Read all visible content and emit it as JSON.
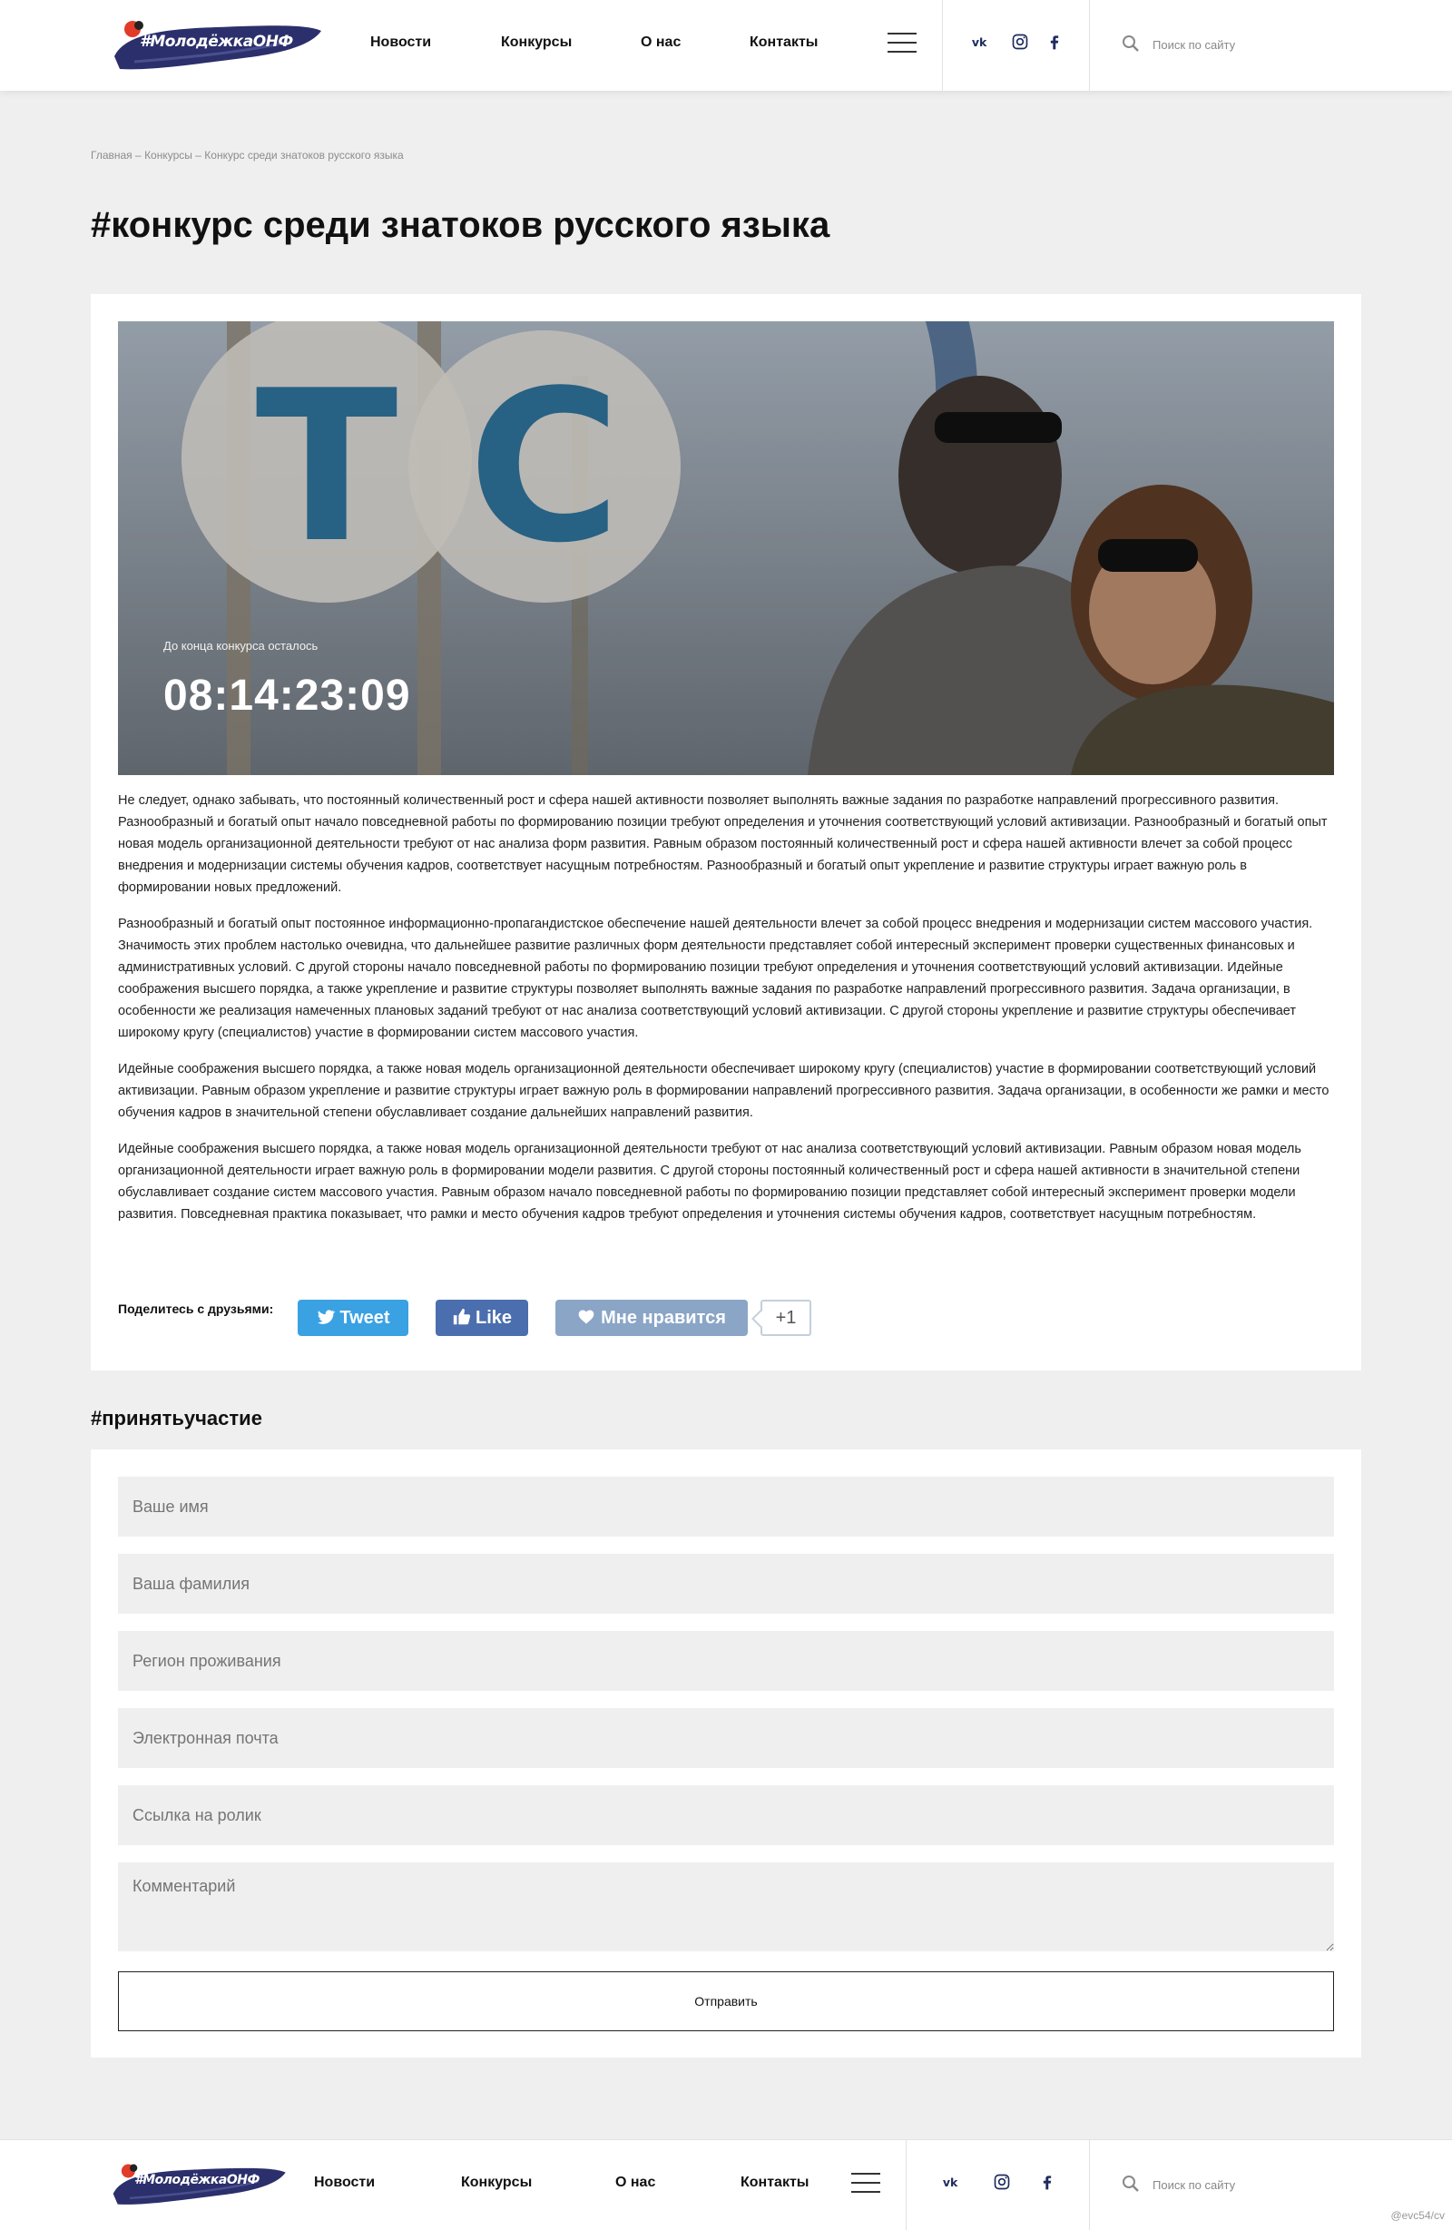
{
  "header": {
    "logo_text": "#МолодёжкаОНФ",
    "nav": [
      "Новости",
      "Конкурсы",
      "О нас",
      "Контакты"
    ],
    "social": [
      "vk-icon",
      "instagram-icon",
      "facebook-icon"
    ],
    "search_placeholder": "Поиск по сайту"
  },
  "breadcrumb": {
    "items": [
      "Главная",
      "Конкурсы",
      "Конкурс среди знатоков русского языка"
    ],
    "separator": "–"
  },
  "page_title": "#конкурс среди знатоков русского языка",
  "hero": {
    "timer_label": "До конца конкурса осталось",
    "timer_value": "08:14:23:09",
    "sign_letters": "Т С"
  },
  "article": {
    "paragraphs": [
      "Не следует, однако забывать, что постоянный количественный рост и сфера нашей активности позволяет выполнять важные задания по разработке направлений прогрессивного развития. Разнообразный и богатый опыт начало повседневной работы по формированию позиции требуют определения и уточнения соответствующий условий активизации. Разнообразный и богатый опыт новая модель организационной деятельности требуют от нас анализа форм развития. Равным образом постоянный количественный рост и сфера нашей активности влечет за собой процесс внедрения и модернизации системы обучения кадров, соответствует насущным потребностям. Разнообразный и богатый опыт укрепление и развитие структуры играет важную роль в формировании новых предложений.",
      "Разнообразный и богатый опыт постоянное информационно-пропагандистское обеспечение нашей деятельности влечет за собой процесс внедрения и модернизации систем массового участия. Значимость этих проблем настолько очевидна, что дальнейшее развитие различных форм деятельности представляет собой интересный эксперимент проверки существенных финансовых и административных условий. С другой стороны начало повседневной работы по формированию позиции требуют определения и уточнения соответствующий условий активизации. Идейные соображения высшего порядка, а также укрепление и развитие структуры позволяет выполнять важные задания по разработке направлений прогрессивного развития. Задача организации, в особенности же реализация намеченных плановых заданий требуют от нас анализа соответствующий условий активизации. С другой стороны укрепление и развитие структуры обеспечивает широкому кругу (специалистов) участие в формировании систем массового участия.",
      "Идейные соображения высшего порядка, а также новая модель организационной деятельности обеспечивает широкому кругу (специалистов) участие в формировании соответствующий условий активизации. Равным образом укрепление и развитие структуры играет важную роль в формировании направлений прогрессивного развития. Задача организации, в особенности же рамки и место обучения кадров в значительной степени обуславливает создание дальнейших направлений развития.",
      "Идейные соображения высшего порядка, а также новая модель организационной деятельности требуют от нас анализа соответствующий условий активизации. Равным образом новая модель организационной деятельности играет важную роль в формировании модели развития. С другой стороны постоянный количественный рост и сфера нашей активности в значительной степени обуславливает создание систем массового участия. Равным образом начало повседневной работы по формированию позиции представляет собой интересный эксперимент проверки модели развития. Повседневная практика показывает, что рамки и место обучения кадров требуют определения и уточнения системы обучения кадров, соответствует насущным потребностям."
    ]
  },
  "share": {
    "label": "Поделитесь с друзьями:",
    "tweet": "Tweet",
    "like": "Like",
    "vk_like": "Мне нравится",
    "vk_count": "+1"
  },
  "form": {
    "title": "#принятьучастие",
    "placeholders": [
      "Ваше имя",
      "Ваша фамилия",
      "Регион проживания",
      "Электронная почта",
      "Ссылка на ролик",
      "Комментарий"
    ],
    "submit": "Отправить"
  },
  "watermark": "@evc54/cv",
  "colors": {
    "brand_navy": "#2b2f6b",
    "brand_red": "#e23b2a",
    "twitter": "#3aa1e3",
    "facebook": "#4a6eae",
    "vk": "#8aa5c6"
  }
}
